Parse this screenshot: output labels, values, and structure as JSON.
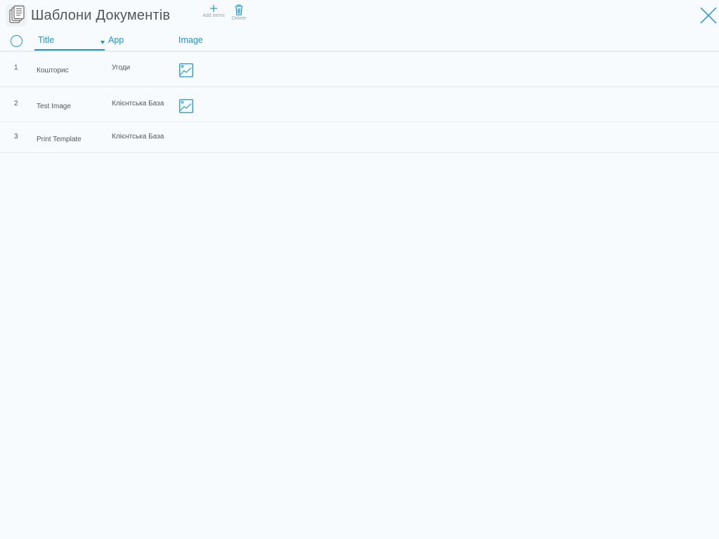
{
  "header": {
    "title": "Шаблони Документів",
    "app_icon": "documents-icon",
    "close_icon": "close-icon"
  },
  "toolbar": {
    "add_label": "Add Items",
    "add_icon": "plus-icon",
    "delete_label": "Delete",
    "delete_icon": "trash-icon"
  },
  "table": {
    "columns": [
      {
        "label": "Title",
        "sorted": "descending"
      },
      {
        "label": "App"
      },
      {
        "label": "Image"
      }
    ],
    "rows": [
      {
        "num": "1",
        "title": "Кошторис",
        "app": "Угоди",
        "has_image": true
      },
      {
        "num": "2",
        "title": "Test Image",
        "app": "Клієнтська База",
        "has_image": true
      },
      {
        "num": "3",
        "title": "Print Template",
        "app": "Клієнтська База",
        "has_image": false
      }
    ]
  },
  "colors": {
    "accent": "#1b95c9",
    "text": "#555555",
    "background": "#f7fbfd",
    "divider": "#e3e8eb"
  }
}
